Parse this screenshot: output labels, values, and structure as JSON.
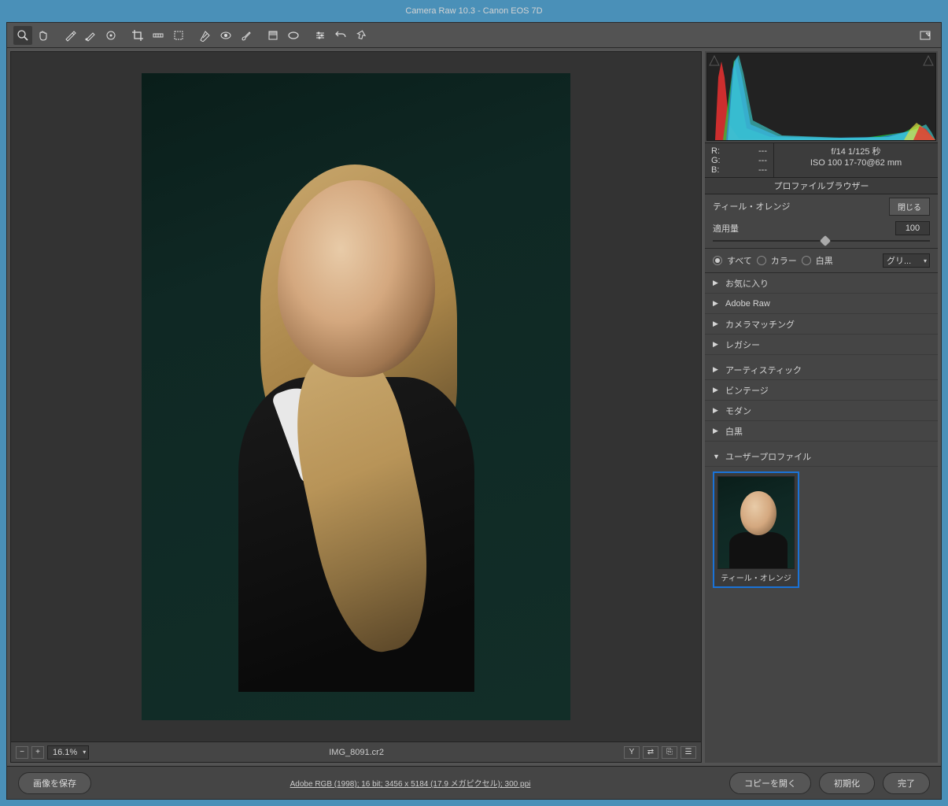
{
  "window": {
    "title": "Camera Raw 10.3  -  Canon EOS 7D"
  },
  "preview": {
    "zoom": "16.1%",
    "filename": "IMG_8091.cr2"
  },
  "meta": {
    "rgb": {
      "r_label": "R:",
      "r_val": "---",
      "g_label": "G:",
      "g_val": "---",
      "b_label": "B:",
      "b_val": "---"
    },
    "exif_line1": "f/14   1/125 秒",
    "exif_line2": "ISO 100    17-70@62 mm"
  },
  "panel": {
    "title": "プロファイルブラウザー",
    "profile_name": "ティール・オレンジ",
    "close": "閉じる",
    "amount_label": "適用量",
    "amount_value": "100",
    "filter": {
      "all": "すべて",
      "color": "カラー",
      "bw": "白黒",
      "grid": "グリ..."
    },
    "groups": {
      "fav": "お気に入り",
      "adobe_raw": "Adobe Raw",
      "camera_match": "カメラマッチング",
      "legacy": "レガシー",
      "artistic": "アーティスティック",
      "vintage": "ビンテージ",
      "modern": "モダン",
      "bw": "白黒",
      "user": "ユーザープロファイル"
    },
    "thumb_label": "ティール・オレンジ"
  },
  "footer": {
    "save": "画像を保存",
    "info": "Adobe RGB (1998); 16 bit; 3456 x 5184 (17.9 メガピクセル); 300 ppi",
    "open_copy": "コピーを開く",
    "reset": "初期化",
    "done": "完了"
  }
}
